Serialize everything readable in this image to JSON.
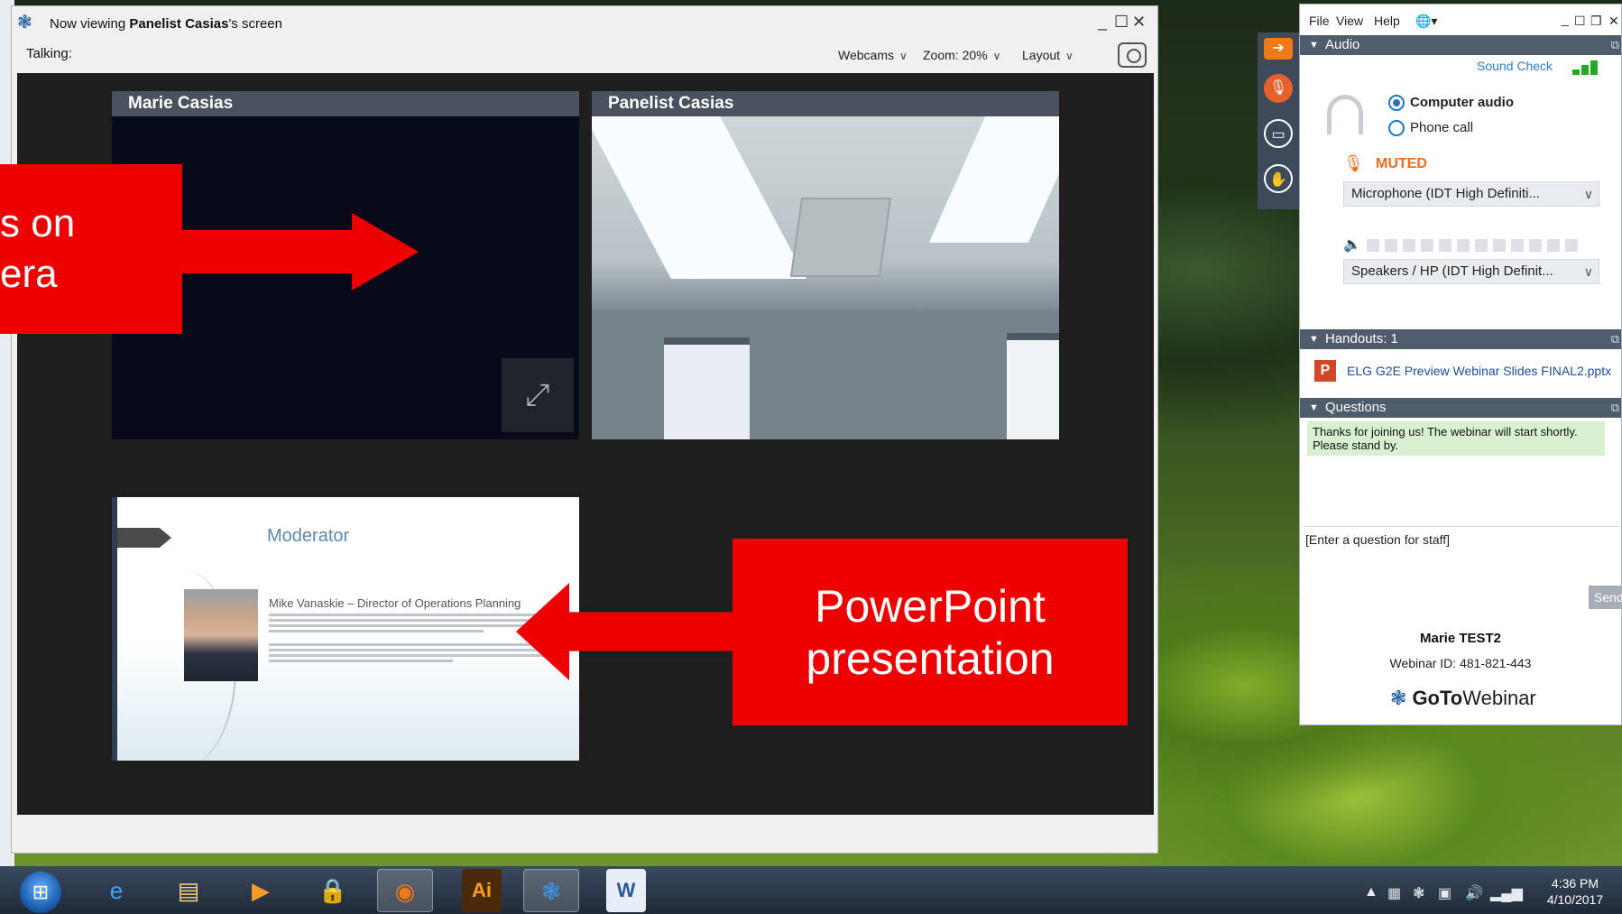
{
  "viewer": {
    "title_prefix": "Now viewing ",
    "title_name": "Panelist Casias",
    "title_suffix": "'s screen",
    "talking_label": "Talking:",
    "toolbar": {
      "webcams": "Webcams",
      "zoom": "Zoom: 20%",
      "layout": "Layout"
    },
    "tiles": [
      {
        "name": "Marie Casias"
      },
      {
        "name": "Panelist Casias"
      }
    ],
    "slide": {
      "title": "Moderator",
      "speaker": "Mike Vanaskie – Director of Operations Planning"
    }
  },
  "annotations": {
    "left": "s on\nera",
    "right_line1": "PowerPoint",
    "right_line2": "presentation"
  },
  "panel": {
    "menu": [
      "File",
      "View",
      "Help"
    ],
    "audio": {
      "header": "Audio",
      "sound_check": "Sound Check",
      "options": [
        "Computer audio",
        "Phone call"
      ],
      "selected": "Computer audio",
      "status": "MUTED",
      "microphone": "Microphone (IDT High Definiti...",
      "speakers": "Speakers / HP (IDT High Definit..."
    },
    "handouts": {
      "header": "Handouts: 1",
      "file": "ELG G2E Preview Webinar Slides FINAL2.pptx"
    },
    "questions": {
      "header": "Questions",
      "message": "Thanks for joining us!  The webinar will start shortly.  Please stand by.",
      "input_placeholder": "[Enter a question for staff]",
      "send_label": "Send"
    },
    "footer": {
      "name": "Marie TEST2",
      "webinar_id": "Webinar ID: 481-821-443",
      "brand_goto": "GoTo",
      "brand_webinar": "Webinar"
    }
  },
  "taskbar": {
    "time": "4:36 PM",
    "date": "4/10/2017",
    "apps": [
      "ie-icon",
      "explorer-icon",
      "media-icon",
      "lock-icon",
      "firefox-icon",
      "illustrator-icon",
      "gotowebinar-icon",
      "word-icon"
    ]
  },
  "colors": {
    "accent_red": "#ee0000",
    "muted_orange": "#ee6a1c",
    "link_blue": "#1a4fa3",
    "panel_header": "#4e5c6b"
  }
}
